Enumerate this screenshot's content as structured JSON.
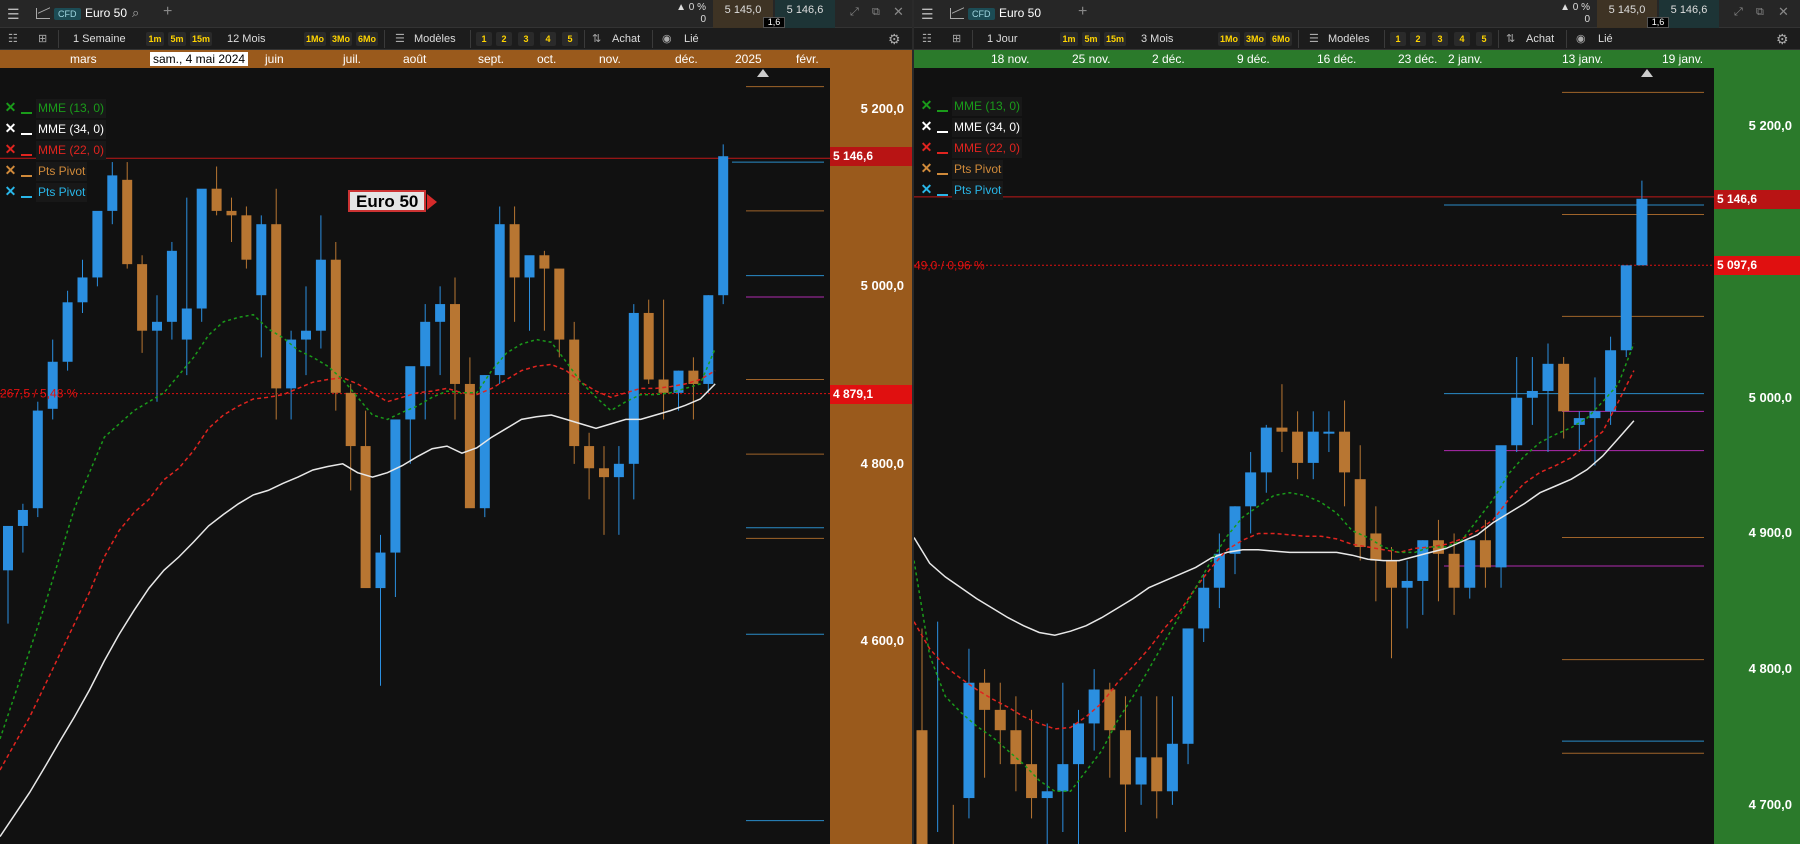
{
  "left": {
    "window": {
      "instrument": "Euro 50",
      "cfd": "CFD",
      "change_pct": "0 %",
      "change_abs": "0",
      "bid": "5 145,0",
      "ask": "5 146,6",
      "spread": "1,6"
    },
    "toolbar": {
      "period": "1 Semaine",
      "r1m": "1m",
      "r5m": "5m",
      "r15m": "15m",
      "range": "12 Mois",
      "r1Mo": "1Mo",
      "r3Mo": "3Mo",
      "r6Mo": "6Mo",
      "templates": "Modèles",
      "n1": "1",
      "n2": "2",
      "n3": "3",
      "n4": "4",
      "n5": "5",
      "buy": "Achat",
      "linked": "Lié"
    },
    "dates": [
      "mars",
      "juin",
      "juil.",
      "août",
      "sept.",
      "oct.",
      "nov.",
      "déc.",
      "2025",
      "févr."
    ],
    "cursor_date": "sam., 4 mai 2024",
    "legend": [
      {
        "name": "MME (13, 0)",
        "color": "#1a9b1a"
      },
      {
        "name": "MME (34, 0)",
        "color": "#ffffff"
      },
      {
        "name": "MME (22, 0)",
        "color": "#e0241f"
      },
      {
        "name": "Pts Pivot",
        "color": "#d08a3a"
      },
      {
        "name": "Pts Pivot",
        "color": "#29b6e8"
      }
    ],
    "badge": "Euro 50",
    "axis": [
      "5 200,0",
      "5 000,0",
      "4 800,0",
      "4 600,0"
    ],
    "price_label": "5 146,6",
    "cross_label": "4 879,1",
    "measure": "267,5 / 5,48 %",
    "colors": {
      "axis_bg": "#9a5a1c",
      "date_bg": "#9a5a1c"
    }
  },
  "right": {
    "window": {
      "instrument": "Euro 50",
      "cfd": "CFD",
      "change_pct": "0 %",
      "change_abs": "0",
      "bid": "5 145,0",
      "ask": "5 146,6",
      "spread": "1,6"
    },
    "toolbar": {
      "period": "1 Jour",
      "r1m": "1m",
      "r5m": "5m",
      "r15m": "15m",
      "range": "3 Mois",
      "r1Mo": "1Mo",
      "r3Mo": "3Mo",
      "r6Mo": "6Mo",
      "templates": "Modèles",
      "n1": "1",
      "n2": "2",
      "n3": "3",
      "n4": "4",
      "n5": "5",
      "buy": "Achat",
      "linked": "Lié"
    },
    "dates": [
      "18 nov.",
      "25 nov.",
      "2 déc.",
      "9 déc.",
      "16 déc.",
      "23 déc.",
      "2 janv.",
      "13 janv.",
      "19 janv."
    ],
    "legend": [
      {
        "name": "MME (13, 0)",
        "color": "#1a9b1a"
      },
      {
        "name": "MME (34, 0)",
        "color": "#ffffff"
      },
      {
        "name": "MME (22, 0)",
        "color": "#e0241f"
      },
      {
        "name": "Pts Pivot",
        "color": "#d08a3a"
      },
      {
        "name": "Pts Pivot",
        "color": "#29b6e8"
      }
    ],
    "axis": [
      "5 200,0",
      "5 000,0",
      "4 900,0",
      "4 800,0",
      "4 700,0"
    ],
    "price_label": "5 146,6",
    "cross_label": "5 097,6",
    "measure": "49,0 / 0,96 %",
    "colors": {
      "axis_bg": "#2b7a2b",
      "date_bg": "#2b7a2b"
    }
  },
  "colors": {
    "up": "#2b8fe0",
    "down": "#b87632",
    "ema13": "#1a9b1a",
    "ema34": "#e8e8e8",
    "ema22": "#e0241f",
    "pivot_orange": "#a0642a",
    "pivot_blue": "#2a8cc8",
    "pivot_purple": "#b02ab0",
    "price_line": "#c01818"
  }
}
